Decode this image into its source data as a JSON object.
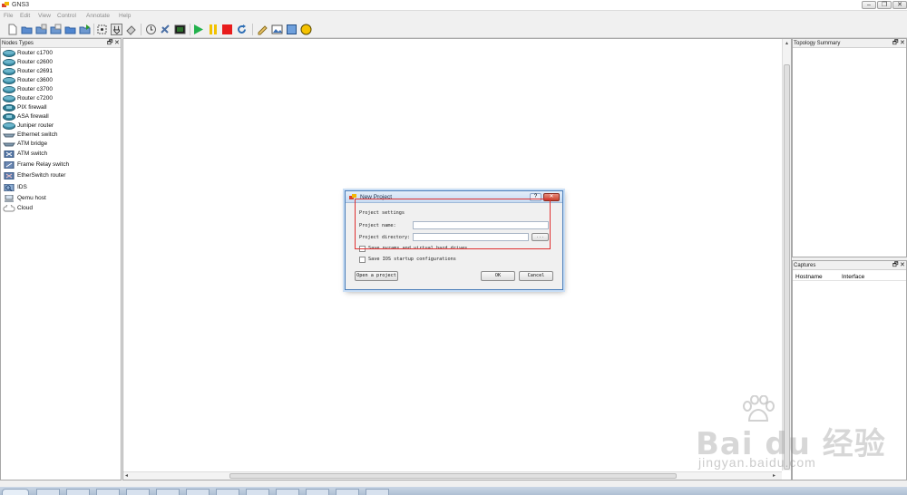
{
  "window": {
    "title": "GNS3",
    "controls": [
      "‒",
      "❐",
      "✕"
    ]
  },
  "menu": [
    "File",
    "Edit",
    "View",
    "Control",
    "Annotate",
    "Help"
  ],
  "toolbar": {
    "icons": [
      "new-icon",
      "open-icon",
      "save-icon",
      "save-as-icon",
      "open-folder-icon",
      "export-icon",
      "show-interface-labels-icon",
      "add-link-icon",
      "capture-icon",
      "console-icon",
      "console-all-icon",
      "terminal-icon",
      "start-icon",
      "pause-icon",
      "stop-icon",
      "reload-icon",
      "note-icon",
      "insert-image-icon",
      "rectangle-icon",
      "ellipse-icon"
    ],
    "colors": {
      "start": "#22b14c",
      "pause": "#f2c200",
      "stop": "#e81c1c",
      "ellipse": "#f5c200",
      "rectangle": "#6fa0dc"
    }
  },
  "node_types": {
    "title": "Nodes Types",
    "items": [
      {
        "label": "Router c1700",
        "icon": "router-icon"
      },
      {
        "label": "Router c2600",
        "icon": "router-icon"
      },
      {
        "label": "Router c2691",
        "icon": "router-icon"
      },
      {
        "label": "Router c3600",
        "icon": "router-icon"
      },
      {
        "label": "Router c3700",
        "icon": "router-icon"
      },
      {
        "label": "Router c7200",
        "icon": "router-icon"
      },
      {
        "label": "PIX firewall",
        "icon": "firewall-icon"
      },
      {
        "label": "ASA firewall",
        "icon": "firewall-icon"
      },
      {
        "label": "Juniper router",
        "icon": "router-icon"
      },
      {
        "label": "Ethernet switch",
        "icon": "switch-icon"
      },
      {
        "label": "ATM bridge",
        "icon": "atm-bridge-icon"
      },
      {
        "label": "ATM switch",
        "icon": "atm-switch-icon"
      },
      {
        "label": "Frame Relay switch",
        "icon": "frame-relay-icon"
      },
      {
        "label": "EtherSwitch router",
        "icon": "etherswitch-icon"
      },
      {
        "label": "IDS",
        "icon": "ids-icon"
      },
      {
        "label": "Qemu host",
        "icon": "host-icon"
      },
      {
        "label": "Cloud",
        "icon": "cloud-icon"
      }
    ]
  },
  "topology": {
    "title": "Topology Summary"
  },
  "captures": {
    "title": "Captures",
    "columns": [
      "Hostname",
      "Interface"
    ]
  },
  "dock_controls": {
    "float": "🗗",
    "close": "✕"
  },
  "dialog": {
    "title": "New Project",
    "help": "?",
    "close": "✕",
    "section": "Project settings",
    "project_name_label": "Project name:",
    "project_name_value": "",
    "project_directory_label": "Project directory:",
    "project_directory_value": "",
    "browse": "...",
    "checkbox1": "Save nvrams and virtual hard drives",
    "checkbox2": "Save IOS startup configurations",
    "open_project": "Open a project",
    "ok": "OK",
    "cancel": "Cancel",
    "highlight_color": "#e03030"
  },
  "watermark": {
    "brand": "Bai du 经验",
    "url": "jingyan.baidu.com"
  }
}
